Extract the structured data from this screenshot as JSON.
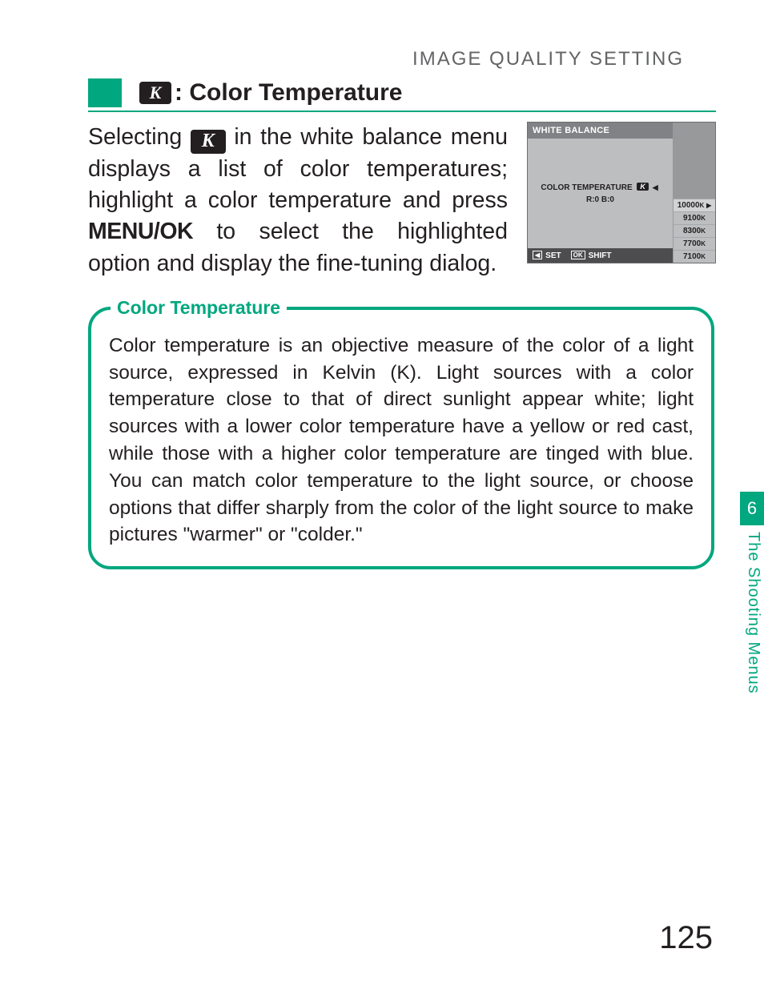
{
  "breadcrumb": "IMAGE QUALITY SETTING",
  "section": {
    "icon_letter": "K",
    "title_rest": ": Color Temperature"
  },
  "main_paragraph": {
    "p1": "Selecting ",
    "icon_letter": "K",
    "p2": " in the white balance menu displays a list of color temperatures; highlight a color temperature and press ",
    "menuok": "MENU/OK",
    "p3": " to select the highlighted option and display the fine-tuning dialog."
  },
  "lcd": {
    "title": "WHITE BALANCE",
    "row_label": "COLOR TEMPERATURE",
    "row_icon": "K",
    "arrow_l": "◀",
    "arrow_r": "▶",
    "shift": "R:0  B:0",
    "foot_set_icon": "◀",
    "foot_set": "SET",
    "foot_ok_icon": "OK",
    "foot_shift": "SHIFT",
    "temps": [
      "10000",
      "9100",
      "8300",
      "7700",
      "7100"
    ],
    "k_suffix": "K"
  },
  "info": {
    "legend": "Color Temperature",
    "text": "Color temperature is an objective measure of the color of a light source, expressed in Kelvin (K). Light sources with a color temperature close to that of direct sunlight appear white; light sources with a lower color temperature have a yellow or red cast, while those with a higher color temperature are tinged with blue. You can match color temperature to the light source, or choose options that differ sharply from the color of the light source to make pictures \"warmer\" or \"colder.\""
  },
  "chapter": {
    "number": "6",
    "label": "The Shooting Menus"
  },
  "page_number": "125"
}
